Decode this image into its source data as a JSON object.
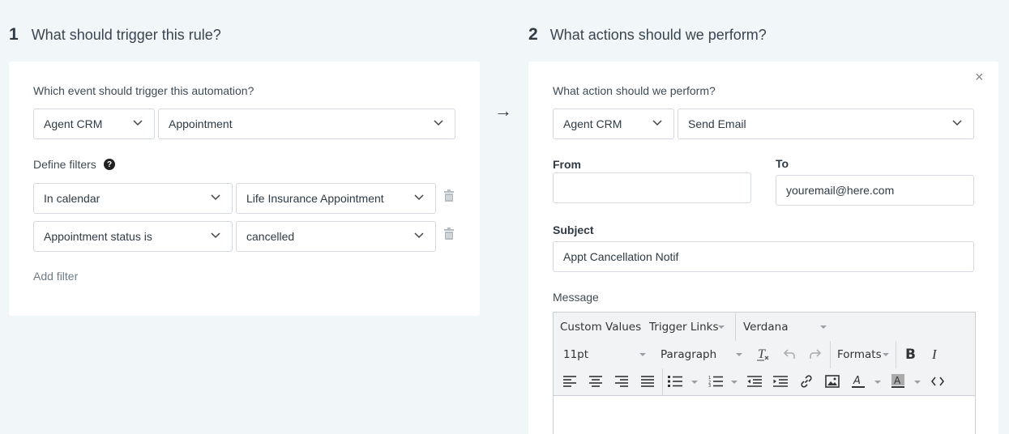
{
  "step1": {
    "number": "1",
    "title": "What should trigger this rule?"
  },
  "step2": {
    "number": "2",
    "title": "What actions should we perform?"
  },
  "trigger": {
    "event_label": "Which event should trigger this automation?",
    "app_select": "Agent CRM",
    "event_select": "Appointment",
    "filters_label": "Define filters",
    "help_icon": "?",
    "filters": [
      {
        "field": "In calendar",
        "value": "Life Insurance Appointment"
      },
      {
        "field": "Appointment status is",
        "value": "cancelled"
      }
    ],
    "add_filter": "Add filter"
  },
  "arrow": "→",
  "action": {
    "close": "×",
    "action_label": "What action should we perform?",
    "app_select": "Agent CRM",
    "action_select": "Send Email",
    "from_label": "From",
    "from_value": "",
    "to_label": "To",
    "to_value": "youremail@here.com",
    "subject_label": "Subject",
    "subject_value": "Appt Cancellation Notif",
    "message_label": "Message"
  },
  "editor": {
    "custom_values": "Custom Values",
    "trigger_links": "Trigger Links",
    "font_family": "Verdana",
    "font_size": "11pt",
    "block_format": "Paragraph",
    "formats": "Formats",
    "bold": "B",
    "italic": "I"
  }
}
